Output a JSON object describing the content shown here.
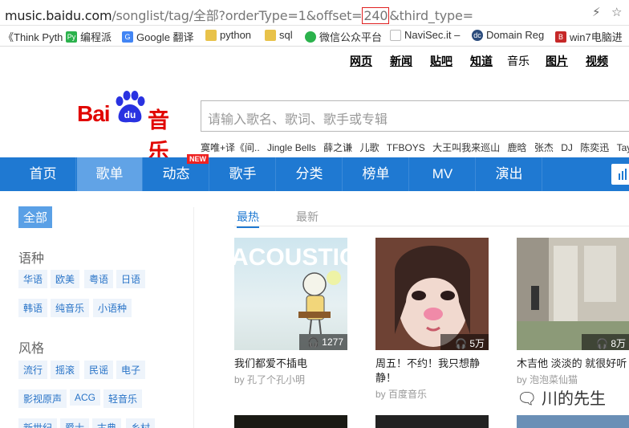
{
  "address": {
    "host": "music.baidu.com",
    "path_before": "/songlist/tag/全部?orderType=1&offset=",
    "highlight": "240",
    "path_after": "&third_type="
  },
  "bookmarks": [
    {
      "label": "《Think Pyth",
      "color": "#555"
    },
    {
      "label": "编程派",
      "color": "#2bb24c"
    },
    {
      "label": "Google 翻译",
      "color": "#4285f4"
    },
    {
      "label": "python",
      "color": "#e8c24a"
    },
    {
      "label": "sql",
      "color": "#e8c24a"
    },
    {
      "label": "微信公众平台",
      "color": "#2bb24c"
    },
    {
      "label": "NaviSec.it –",
      "color": "#bbb"
    },
    {
      "label": "Domain Reg",
      "color": "#2a4b7c"
    },
    {
      "label": "win7电脑进",
      "color": "#c62828"
    }
  ],
  "toplinks": [
    "网页",
    "新闻",
    "贴吧",
    "知道",
    "音乐",
    "图片",
    "视频"
  ],
  "logo": {
    "bai": "Bai",
    "du": "du",
    "music": "音乐"
  },
  "search": {
    "placeholder": "请输入歌名、歌词、歌手或专辑"
  },
  "hot": [
    "寞唯+译《间..",
    "Jingle Bells",
    "薛之谦",
    "儿歌",
    "TFBOYS",
    "大王叫我来巡山",
    "鹿晗",
    "张杰",
    "DJ",
    "陈奕迅",
    "Taylor Sw"
  ],
  "nav": {
    "items": [
      "首页",
      "歌单",
      "动态",
      "歌手",
      "分类",
      "榜单",
      "MV",
      "演出"
    ],
    "active": 1,
    "badge": "NEW"
  },
  "sidebar": {
    "all": "全部",
    "groups": [
      {
        "title": "语种",
        "tags": [
          "华语",
          "欧美",
          "粤语",
          "日语",
          "韩语",
          "纯音乐",
          "小语种"
        ]
      },
      {
        "title": "风格",
        "tags": [
          "流行",
          "摇滚",
          "民谣",
          "电子",
          "影视原声",
          "ACG",
          "轻音乐",
          "新世纪",
          "爵士",
          "古典",
          "乡村"
        ]
      }
    ]
  },
  "tabs": [
    "最热",
    "最新"
  ],
  "cards": [
    {
      "title": "我们都爱不插电",
      "by": "by 孔了个孔小明",
      "count": "1277",
      "art": "ACOUSTIC UNPLUGGED LIVE"
    },
    {
      "title": "周五！不约！我只想静静！",
      "by": "by 百度音乐",
      "count": "5万",
      "art": ""
    },
    {
      "title": "木吉他 淡淡的 就很好听",
      "by": "by 泡泡菜仙猫",
      "count": "8万",
      "art": ""
    }
  ],
  "watermark": "川的先生",
  "colors": {
    "brand_red": "#e10601",
    "nav_blue": "#1f79d2",
    "nav_active": "#61a3e6",
    "link_blue": "#2873c7"
  }
}
